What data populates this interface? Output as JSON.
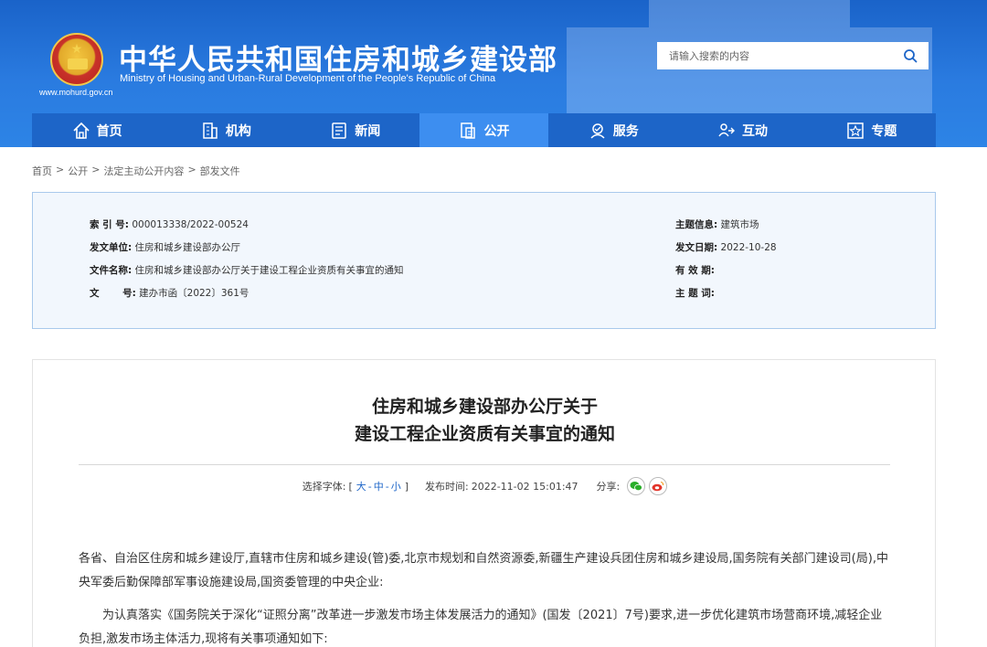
{
  "header": {
    "title": "中华人民共和国住房和城乡建设部",
    "subtitle": "Ministry of Housing and Urban-Rural Development of the People's Republic of China",
    "url": "www.mohurd.gov.cn",
    "search_placeholder": "请输入搜索的内容"
  },
  "nav": {
    "items": [
      {
        "label": "首页",
        "icon": "home-icon"
      },
      {
        "label": "机构",
        "icon": "building-icon"
      },
      {
        "label": "新闻",
        "icon": "news-icon"
      },
      {
        "label": "公开",
        "icon": "document-icon",
        "active": true
      },
      {
        "label": "服务",
        "icon": "service-icon"
      },
      {
        "label": "互动",
        "icon": "interact-icon"
      },
      {
        "label": "专题",
        "icon": "star-icon"
      }
    ]
  },
  "breadcrumb": [
    "首页",
    "公开",
    "法定主动公开内容",
    "部发文件"
  ],
  "breadcrumb_sep": ">",
  "info": {
    "index_label": "索 引 号:",
    "index_value": "000013338/2022-00524",
    "issuer_label": "发文单位:",
    "issuer_value": "住房和城乡建设部办公厅",
    "docname_label": "文件名称:",
    "docname_value": "住房和城乡建设部办公厅关于建设工程企业资质有关事宜的通知",
    "docno_label": "文       号:",
    "docno_value": "建办市函〔2022〕361号",
    "topic_label": "主题信息:",
    "topic_value": "建筑市场",
    "date_label": "发文日期:",
    "date_value": "2022-10-28",
    "validity_label": "有 效 期:",
    "validity_value": "",
    "keywords_label": "主 题 词:",
    "keywords_value": ""
  },
  "article": {
    "title_line1": "住房和城乡建设部办公厅关于",
    "title_line2": "建设工程企业资质有关事宜的通知",
    "font_label": "选择字体:",
    "font_open": "[",
    "font_large": "大",
    "font_dash1": "-",
    "font_medium": "中",
    "font_dash2": "-",
    "font_small": "小",
    "font_close": "]",
    "publish_label": "发布时间:",
    "publish_time": "2022-11-02 15:01:47",
    "share_label": "分享:",
    "para1": "各省、自治区住房和城乡建设厅,直辖市住房和城乡建设(管)委,北京市规划和自然资源委,新疆生产建设兵团住房和城乡建设局,国务院有关部门建设司(局),中央军委后勤保障部军事设施建设局,国资委管理的中央企业:",
    "para2": "为认真落实《国务院关于深化“证照分离”改革进一步激发市场主体发展活力的通知》(国发〔2021〕7号)要求,进一步优化建筑市场营商环境,减轻企业负担,激发市场主体活力,现将有关事项通知如下:"
  },
  "colors": {
    "header_blue": "#1a63c9",
    "nav_blue": "#1d65c8",
    "nav_active": "#3d8ef0",
    "info_bg": "#f2f7fd",
    "wechat_green": "#2aae2a",
    "weibo_red": "#e2342a"
  }
}
